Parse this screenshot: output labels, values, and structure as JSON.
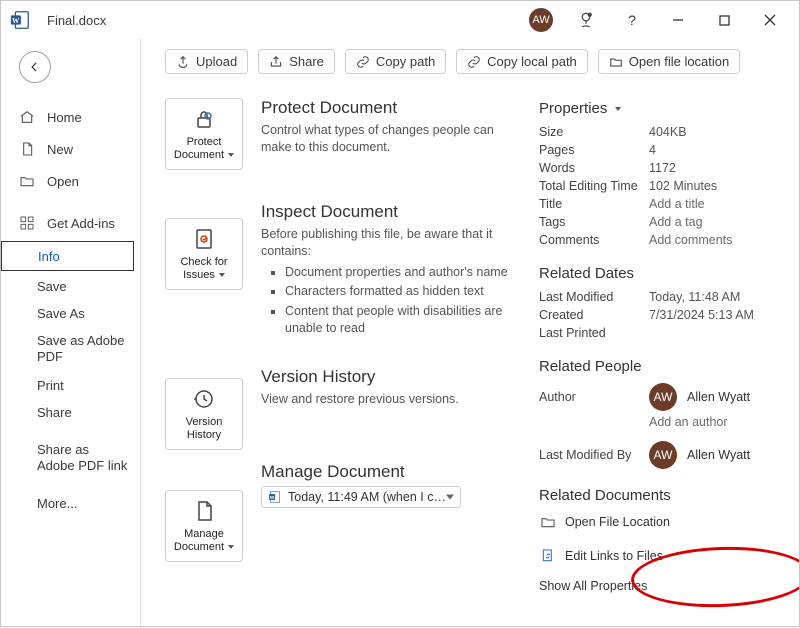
{
  "titlebar": {
    "filename": "Final.docx",
    "avatar_initials": "AW"
  },
  "sidebar": {
    "home": "Home",
    "new": "New",
    "open": "Open",
    "get_addins": "Get Add-ins",
    "info": "Info",
    "save": "Save",
    "save_as": "Save As",
    "save_adobe": "Save as Adobe PDF",
    "print": "Print",
    "share": "Share",
    "share_adobe": "Share as Adobe PDF link",
    "more": "More..."
  },
  "toolbar": {
    "upload": "Upload",
    "share": "Share",
    "copy_path": "Copy path",
    "copy_local_path": "Copy local path",
    "open_location": "Open file location"
  },
  "tiles": {
    "protect": "Protect Document",
    "check": "Check for Issues",
    "version": "Version History",
    "manage": "Manage Document"
  },
  "sections": {
    "protect": {
      "title": "Protect Document",
      "desc": "Control what types of changes people can make to this document."
    },
    "inspect": {
      "title": "Inspect Document",
      "desc": "Before publishing this file, be aware that it contains:",
      "b1": "Document properties and author's name",
      "b2": "Characters formatted as hidden text",
      "b3": "Content that people with disabilities are unable to read"
    },
    "version": {
      "title": "Version History",
      "desc": "View and restore previous versions."
    },
    "manage": {
      "title": "Manage Document",
      "recent": "Today, 11:49 AM (when I closed..."
    }
  },
  "props": {
    "header": "Properties",
    "size_l": "Size",
    "size_v": "404KB",
    "pages_l": "Pages",
    "pages_v": "4",
    "words_l": "Words",
    "words_v": "1172",
    "time_l": "Total Editing Time",
    "time_v": "102 Minutes",
    "title_l": "Title",
    "title_v": "Add a title",
    "tags_l": "Tags",
    "tags_v": "Add a tag",
    "comments_l": "Comments",
    "comments_v": "Add comments"
  },
  "dates": {
    "header": "Related Dates",
    "mod_l": "Last Modified",
    "mod_v": "Today, 11:48 AM",
    "created_l": "Created",
    "created_v": "7/31/2024 5:13 AM",
    "printed_l": "Last Printed"
  },
  "people": {
    "header": "Related People",
    "author_l": "Author",
    "author_name": "Allen Wyatt",
    "author_initials": "AW",
    "add_author": "Add an author",
    "lastmod_l": "Last Modified By",
    "lastmod_name": "Allen Wyatt",
    "lastmod_initials": "AW"
  },
  "related_docs": {
    "header": "Related Documents",
    "open_loc": "Open File Location",
    "edit_links": "Edit Links to Files",
    "show_all": "Show All Properties"
  }
}
